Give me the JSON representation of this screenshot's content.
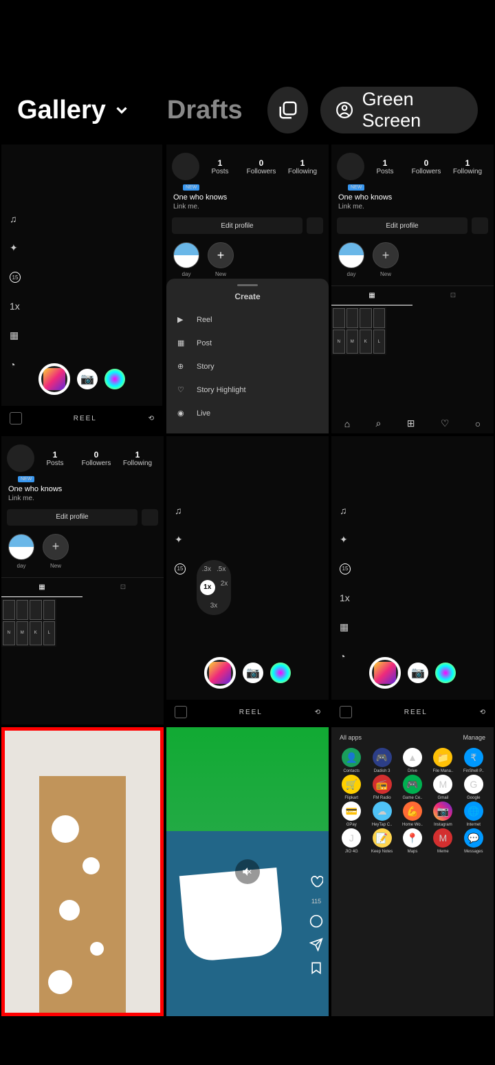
{
  "header": {
    "gallery_label": "Gallery",
    "drafts_label": "Drafts",
    "green_screen_label": "Green Screen"
  },
  "mini_profile": {
    "stats": {
      "posts_num": "1",
      "posts_label": "Posts",
      "followers_num": "0",
      "followers_label": "Followers",
      "following_num": "1",
      "following_label": "Following"
    },
    "badge": "NEW",
    "name": "One who knows",
    "link": "Link me.",
    "edit_label": "Edit profile",
    "story_day": "day",
    "story_new": "New"
  },
  "create_sheet": {
    "title": "Create",
    "items": [
      "Reel",
      "Post",
      "Story",
      "Story Highlight",
      "Live"
    ]
  },
  "reel_cam": {
    "speed": "1x",
    "timer": "15",
    "reel_label": "REEL"
  },
  "speed_options": {
    "p3": ".3x",
    "p5": ".5x",
    "x1": "1x",
    "x2": "2x",
    "x3": "3x"
  },
  "scenic": {
    "likes": "115"
  },
  "drawer": {
    "all_apps": "All apps",
    "manage": "Manage",
    "apps": [
      {
        "n": "Contacts",
        "c": "#1a9e5c",
        "g": "👤"
      },
      {
        "n": "Dadish 3",
        "c": "#2c3e88",
        "g": "🎮"
      },
      {
        "n": "Drive",
        "c": "#fff",
        "g": "▲"
      },
      {
        "n": "File Mana..",
        "c": "#ffc107",
        "g": "📁"
      },
      {
        "n": "FinShell P..",
        "c": "#0099ff",
        "g": "₹"
      },
      {
        "n": "Flipkart",
        "c": "#ffd000",
        "g": "🛒"
      },
      {
        "n": "FM Radio",
        "c": "#d32f2f",
        "g": "📻"
      },
      {
        "n": "Game Ce..",
        "c": "#00b050",
        "g": "🎮"
      },
      {
        "n": "Gmail",
        "c": "#fff",
        "g": "M"
      },
      {
        "n": "Google",
        "c": "#fff",
        "g": "G"
      },
      {
        "n": "GPay",
        "c": "#fff",
        "g": "💳"
      },
      {
        "n": "HeyTap C..",
        "c": "#4fc3f7",
        "g": "☁"
      },
      {
        "n": "Home Wo..",
        "c": "#ff6b35",
        "g": "💪"
      },
      {
        "n": "Instagram",
        "c": "linear-gradient(45deg,#f9ce34,#ee2a7b,#6228d7)",
        "g": "📷"
      },
      {
        "n": "Internet",
        "c": "#0099ff",
        "g": "🌐"
      },
      {
        "n": "JIO 4G",
        "c": "#fff",
        "g": "J"
      },
      {
        "n": "Keep Notes",
        "c": "#ffd54f",
        "g": "📝"
      },
      {
        "n": "Maps",
        "c": "#fff",
        "g": "📍"
      },
      {
        "n": "Meme",
        "c": "#d32f2f",
        "g": "M"
      },
      {
        "n": "Messages",
        "c": "#0099ff",
        "g": "💬"
      }
    ]
  }
}
